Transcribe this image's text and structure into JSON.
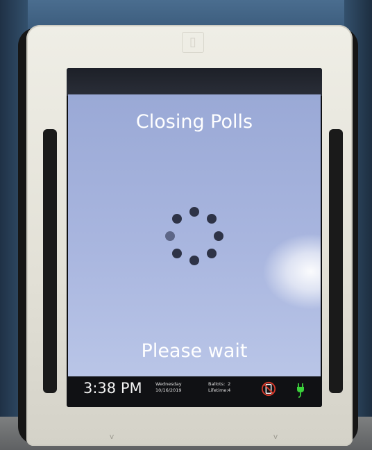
{
  "screen": {
    "title": "Closing Polls",
    "message": "Please wait"
  },
  "status_bar": {
    "time": "3:38 PM",
    "day": "Wednesday",
    "date": "10/16/2019",
    "ballots_label": "Ballots:",
    "ballots_value": "2",
    "lifetime_label": "Lifetime:",
    "lifetime_value": "4"
  },
  "icons": {
    "no_device": "no-device-icon",
    "power": "power-plug-icon",
    "spinner": "loading-spinner"
  },
  "colors": {
    "screen_background": "#a9b6df",
    "status_bar": "#101114",
    "no_device_red": "#d93a2b",
    "power_green": "#3bd23b"
  }
}
